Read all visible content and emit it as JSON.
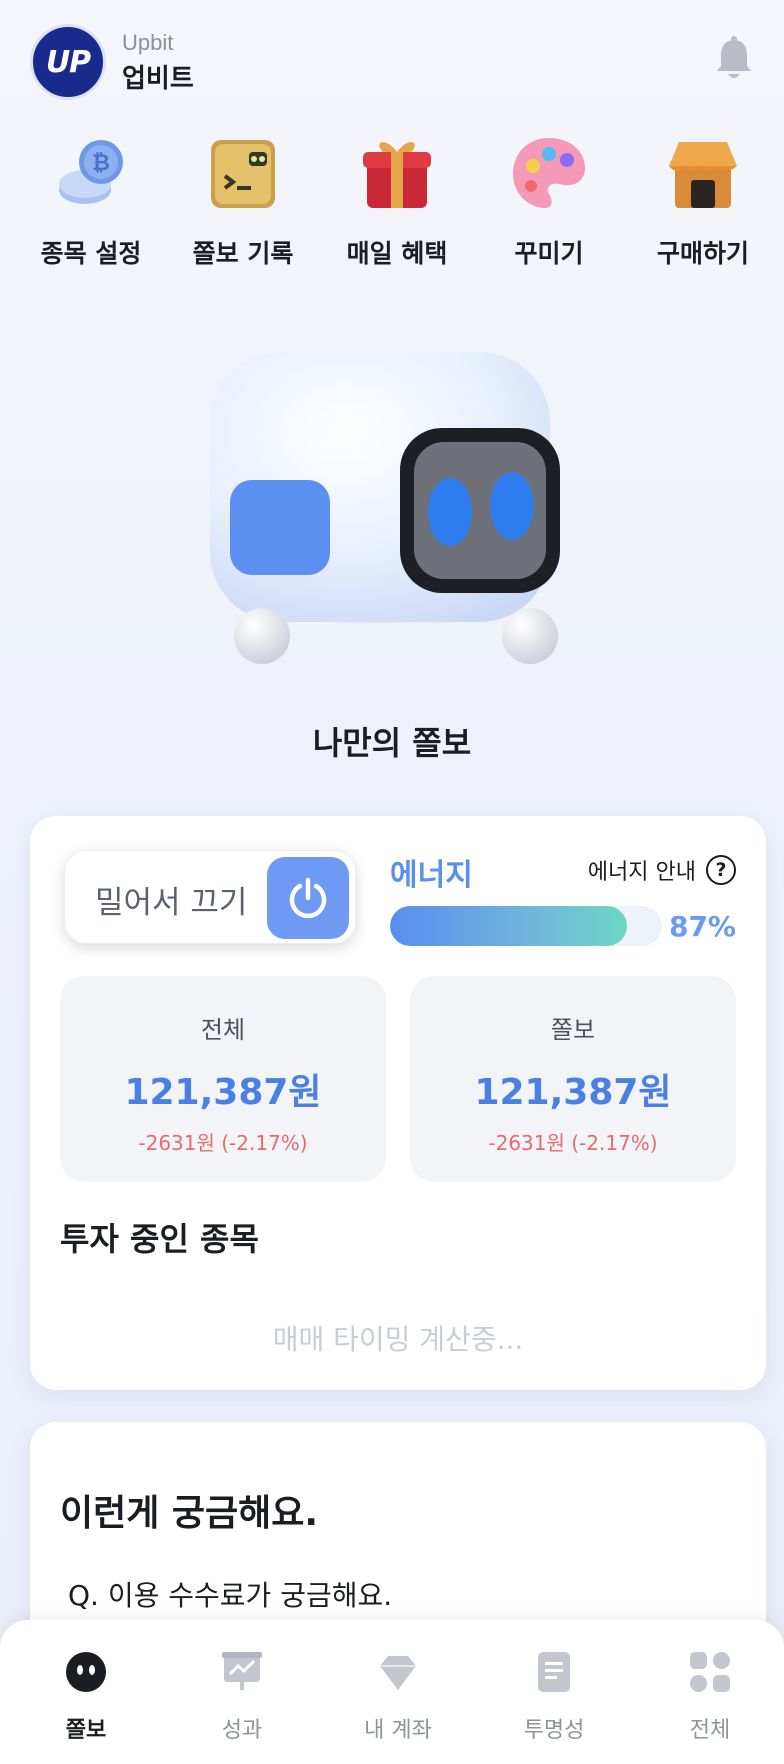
{
  "header": {
    "logo_text": "UP",
    "brand_en": "Upbit",
    "brand_ko": "업비트",
    "bell_icon": "bell-icon"
  },
  "quick_menu": [
    {
      "label": "종목 설정",
      "icon": "coins-icon"
    },
    {
      "label": "쫄보 기록",
      "icon": "record-box-icon"
    },
    {
      "label": "매일 혜택",
      "icon": "gift-icon"
    },
    {
      "label": "꾸미기",
      "icon": "palette-icon"
    },
    {
      "label": "구매하기",
      "icon": "shop-icon"
    }
  ],
  "bot": {
    "name": "나만의 쫄보"
  },
  "control": {
    "slide_text": "밀어서 끄기",
    "energy_label": "에너지",
    "energy_guide": "에너지 안내",
    "energy_help": "?",
    "energy_percent_text": "87%",
    "energy_level": 0.87
  },
  "stats": {
    "total": {
      "title": "전체",
      "value": "121,387원",
      "change": "-2631원 (-2.17%)"
    },
    "bot": {
      "title": "쫄보",
      "value": "121,387원",
      "change": "-2631원 (-2.17%)"
    }
  },
  "investing": {
    "title": "투자 중인 종목",
    "status": "매매 타이밍 계산중..."
  },
  "faq": {
    "title": "이런게 궁금해요.",
    "question": "Q. 이용 수수료가 궁금해요."
  },
  "nav": [
    {
      "label": "쫄보",
      "icon": "bot-face-icon",
      "active": true
    },
    {
      "label": "성과",
      "icon": "chart-board-icon",
      "active": false
    },
    {
      "label": "내 계좌",
      "icon": "diamond-icon",
      "active": false
    },
    {
      "label": "투명성",
      "icon": "document-icon",
      "active": false
    },
    {
      "label": "전체",
      "icon": "grid-icon",
      "active": false
    }
  ],
  "colors": {
    "accent": "#5a8fec",
    "negative": "#e86a6a",
    "brand": "#1a2a8c"
  }
}
